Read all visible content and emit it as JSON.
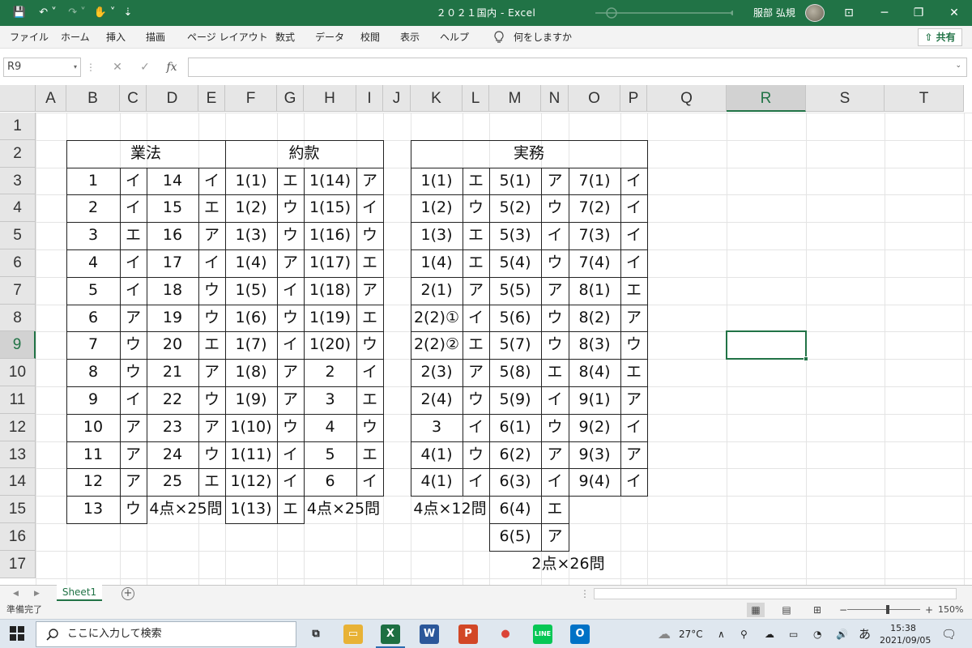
{
  "titlebar": {
    "doc_title": "２０２１国内  -  Excel",
    "user_name": "服部 弘規",
    "qa_items": [
      "💾",
      "↶ ˅",
      "↷ ˅",
      "✋ ˅",
      "⇣"
    ],
    "win_buttons": [
      "⊡",
      "─",
      "❐",
      "✕"
    ]
  },
  "ribbon": {
    "tabs": [
      "ファイル",
      "ホーム",
      "挿入",
      "描画",
      "ページ レイアウト",
      "数式",
      "データ",
      "校閲",
      "表示",
      "ヘルプ"
    ],
    "tell_me": "何をしますか",
    "share": "共有"
  },
  "formula_bar": {
    "name_box": "R9",
    "name_dd": "▾",
    "cancel": "✕",
    "enter": "✓",
    "fx": "fx",
    "colon": "⋮",
    "formula": "",
    "formula_dd": "⌄"
  },
  "grid": {
    "columns": [
      "A",
      "B",
      "C",
      "D",
      "E",
      "F",
      "G",
      "H",
      "I",
      "J",
      "K",
      "L",
      "M",
      "N",
      "O",
      "P",
      "Q",
      "R",
      "S",
      "T"
    ],
    "rows": [
      "1",
      "2",
      "3",
      "4",
      "5",
      "6",
      "7",
      "8",
      "9",
      "10",
      "11",
      "12",
      "13",
      "14",
      "15",
      "16",
      "17"
    ],
    "selected_column": "R",
    "selected_row": "9"
  },
  "sheet": {
    "gyoho_header": "業法",
    "yakkan_header": "約款",
    "jitsumu_header": "実務",
    "gyoho_summary": "4点×25問",
    "yakkan_summary": "4点×25問",
    "jitsumu_summary1": "4点×12問",
    "jitsumu_summary2": "2点×26問",
    "gyoho": [
      [
        "1",
        "イ",
        "14",
        "イ"
      ],
      [
        "2",
        "イ",
        "15",
        "エ"
      ],
      [
        "3",
        "エ",
        "16",
        "ア"
      ],
      [
        "4",
        "イ",
        "17",
        "イ"
      ],
      [
        "5",
        "イ",
        "18",
        "ウ"
      ],
      [
        "6",
        "ア",
        "19",
        "ウ"
      ],
      [
        "7",
        "ウ",
        "20",
        "エ"
      ],
      [
        "8",
        "ウ",
        "21",
        "ア"
      ],
      [
        "9",
        "イ",
        "22",
        "ウ"
      ],
      [
        "10",
        "ア",
        "23",
        "ア"
      ],
      [
        "11",
        "ア",
        "24",
        "ウ"
      ],
      [
        "12",
        "ア",
        "25",
        "エ"
      ],
      [
        "13",
        "ウ",
        "",
        ""
      ]
    ],
    "yakkan": [
      [
        "1(1)",
        "エ",
        "1(14)",
        "ア"
      ],
      [
        "1(2)",
        "ウ",
        "1(15)",
        "イ"
      ],
      [
        "1(3)",
        "ウ",
        "1(16)",
        "ウ"
      ],
      [
        "1(4)",
        "ア",
        "1(17)",
        "エ"
      ],
      [
        "1(5)",
        "イ",
        "1(18)",
        "ア"
      ],
      [
        "1(6)",
        "ウ",
        "1(19)",
        "エ"
      ],
      [
        "1(7)",
        "イ",
        "1(20)",
        "ウ"
      ],
      [
        "1(8)",
        "ア",
        "2",
        "イ"
      ],
      [
        "1(9)",
        "ア",
        "3",
        "エ"
      ],
      [
        "1(10)",
        "ウ",
        "4",
        "ウ"
      ],
      [
        "1(11)",
        "イ",
        "5",
        "エ"
      ],
      [
        "1(12)",
        "イ",
        "6",
        "イ"
      ],
      [
        "1(13)",
        "エ",
        "",
        ""
      ]
    ],
    "jitsumu": [
      [
        "1(1)",
        "エ",
        "5(1)",
        "ア",
        "7(1)",
        "イ"
      ],
      [
        "1(2)",
        "ウ",
        "5(2)",
        "ウ",
        "7(2)",
        "イ"
      ],
      [
        "1(3)",
        "エ",
        "5(3)",
        "イ",
        "7(3)",
        "イ"
      ],
      [
        "1(4)",
        "エ",
        "5(4)",
        "ウ",
        "7(4)",
        "イ"
      ],
      [
        "2(1)",
        "ア",
        "5(5)",
        "ア",
        "8(1)",
        "エ"
      ],
      [
        "2(2)①",
        "イ",
        "5(6)",
        "ウ",
        "8(2)",
        "ア"
      ],
      [
        "2(2)②",
        "エ",
        "5(7)",
        "ウ",
        "8(3)",
        "ウ"
      ],
      [
        "2(3)",
        "ア",
        "5(8)",
        "エ",
        "8(4)",
        "エ"
      ],
      [
        "2(4)",
        "ウ",
        "5(9)",
        "イ",
        "9(1)",
        "ア"
      ],
      [
        "3",
        "イ",
        "6(1)",
        "ウ",
        "9(2)",
        "イ"
      ],
      [
        "4(1)",
        "ウ",
        "6(2)",
        "ア",
        "9(3)",
        "ア"
      ],
      [
        "4(1)",
        "イ",
        "6(3)",
        "イ",
        "9(4)",
        "イ"
      ],
      [
        "",
        "",
        "6(4)",
        "エ",
        "",
        ""
      ],
      [
        "",
        "",
        "6(5)",
        "ア",
        "",
        ""
      ]
    ]
  },
  "sheet_tabs": {
    "nav_prev": "◀",
    "nav_next": "▶",
    "active": "Sheet1",
    "add": "+",
    "more": "⋮"
  },
  "status": {
    "text": "準備完了",
    "zoom": "150%",
    "zoom_minus": "−",
    "zoom_plus": "+",
    "view_icons": [
      "▦",
      "▤",
      "⊞"
    ]
  },
  "taskbar": {
    "search_placeholder": "ここに入力して検索",
    "apps": [
      {
        "name": "task-view",
        "label": "⧉",
        "color": "#dfe7ef",
        "fg": "#222"
      },
      {
        "name": "explorer",
        "label": "▭",
        "color": "#e8b236",
        "fg": "#fff"
      },
      {
        "name": "excel",
        "label": "X",
        "color": "#1d6f42",
        "fg": "#fff"
      },
      {
        "name": "word",
        "label": "W",
        "color": "#2b579a",
        "fg": "#fff"
      },
      {
        "name": "powerpoint",
        "label": "P",
        "color": "#d24726",
        "fg": "#fff"
      },
      {
        "name": "chrome",
        "label": "●",
        "color": "#dfe7ef",
        "fg": "#db4437"
      },
      {
        "name": "line",
        "label": "LINE",
        "color": "#06c755",
        "fg": "#fff"
      },
      {
        "name": "outlook",
        "label": "O",
        "color": "#0072c6",
        "fg": "#fff"
      }
    ],
    "weather": "27°C",
    "tray_icons": [
      "∧",
      "⚲",
      "☁",
      "▭",
      "◔",
      "🔊"
    ],
    "ime": "あ",
    "time": "15:38",
    "date": "2021/09/05",
    "notify": "🗨"
  }
}
